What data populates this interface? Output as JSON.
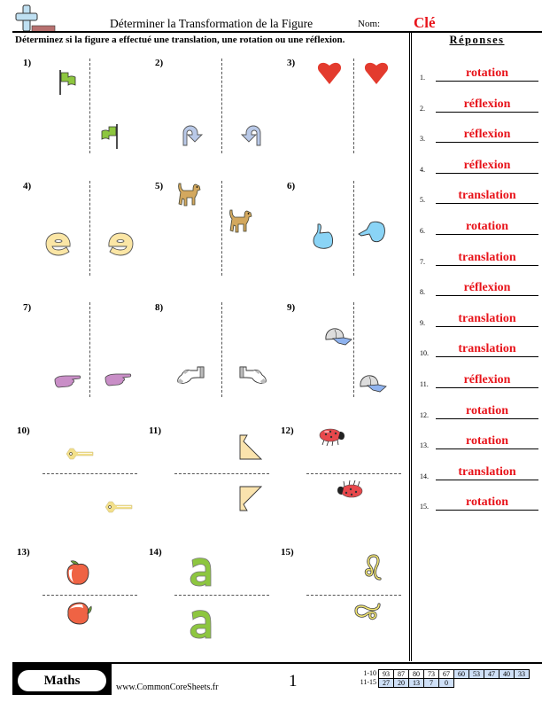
{
  "header": {
    "title": "Déterminer la Transformation de la Figure",
    "name_label": "Nom:",
    "name_value": "Clé"
  },
  "instructions": "Déterminez si la figure a effectué une translation, une rotation ou une réflexion.",
  "answers": {
    "title": "Réponses",
    "items": [
      {
        "num": "1.",
        "value": "rotation"
      },
      {
        "num": "2.",
        "value": "réflexion"
      },
      {
        "num": "3.",
        "value": "réflexion"
      },
      {
        "num": "4.",
        "value": "réflexion"
      },
      {
        "num": "5.",
        "value": "translation"
      },
      {
        "num": "6.",
        "value": "rotation"
      },
      {
        "num": "7.",
        "value": "translation"
      },
      {
        "num": "8.",
        "value": "réflexion"
      },
      {
        "num": "9.",
        "value": "translation"
      },
      {
        "num": "10.",
        "value": "translation"
      },
      {
        "num": "11.",
        "value": "réflexion"
      },
      {
        "num": "12.",
        "value": "rotation"
      },
      {
        "num": "13.",
        "value": "rotation"
      },
      {
        "num": "14.",
        "value": "translation"
      },
      {
        "num": "15.",
        "value": "rotation"
      }
    ]
  },
  "problems": [
    {
      "label": "1)",
      "figure": "flag-icon"
    },
    {
      "label": "2)",
      "figure": "u-turn-arrow-icon"
    },
    {
      "label": "3)",
      "figure": "heart-icon"
    },
    {
      "label": "4)",
      "figure": "letter-e-icon"
    },
    {
      "label": "5)",
      "figure": "dog-icon"
    },
    {
      "label": "6)",
      "figure": "thumbs-up-icon"
    },
    {
      "label": "7)",
      "figure": "pointing-hand-icon"
    },
    {
      "label": "8)",
      "figure": "sock-icon"
    },
    {
      "label": "9)",
      "figure": "cap-icon"
    },
    {
      "label": "10)",
      "figure": "key-icon"
    },
    {
      "label": "11)",
      "figure": "notched-shape-icon"
    },
    {
      "label": "12)",
      "figure": "ladybug-icon"
    },
    {
      "label": "13)",
      "figure": "apple-icon"
    },
    {
      "label": "14)",
      "figure": "letter-a-icon"
    },
    {
      "label": "15)",
      "figure": "leo-symbol-icon"
    }
  ],
  "footer": {
    "subject": "Maths",
    "website": "www.CommonCoreSheets.fr",
    "page": "1",
    "score_rows": [
      {
        "label": "1-10",
        "cells": [
          "93",
          "87",
          "80",
          "73",
          "67",
          "60",
          "53",
          "47",
          "40",
          "33"
        ]
      },
      {
        "label": "11-15",
        "cells": [
          "27",
          "20",
          "13",
          "7",
          "0"
        ]
      }
    ]
  },
  "colors": {
    "answer_red": "#e8141b",
    "score_blue": "#cfe0f7",
    "flag_green": "#8dc63f",
    "arrow_blue": "#b9c9e8",
    "heart_red": "#e33b2e",
    "letter_yellow": "#fbe6a5",
    "dog_tan": "#d3a85e",
    "thumb_blue": "#8ad4f6",
    "hand_pink": "#c98ec7",
    "cap_blue": "#8fb3ef",
    "key_yellow": "#f3e08a",
    "shape_yellow": "#fae3ad",
    "ladybug_red": "#e8484c",
    "apple_red": "#ef6344",
    "letter_a_green": "#8dc63f"
  }
}
